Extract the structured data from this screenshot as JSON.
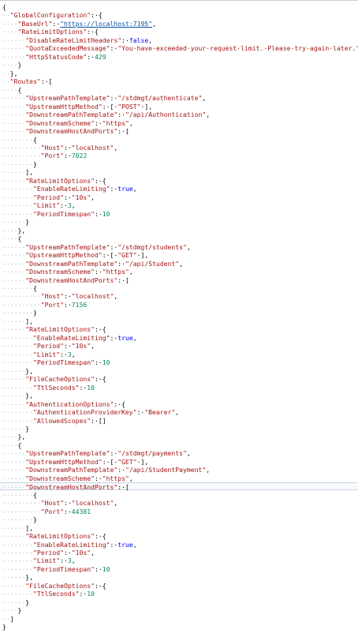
{
  "editor": {
    "highlighted_line_index": 58,
    "lines": [
      [
        [
          "p",
          "{"
        ]
      ],
      [
        [
          "ws",
          "··"
        ],
        [
          "k",
          "\"GlobalConfiguration\""
        ],
        [
          "p",
          ":·{"
        ]
      ],
      [
        [
          "ws",
          "····"
        ],
        [
          "k",
          "\"BaseUrl\""
        ],
        [
          "p",
          ":·"
        ],
        [
          "u",
          "\"https://localhost:7195\""
        ],
        [
          "p",
          ","
        ]
      ],
      [
        [
          "ws",
          "····"
        ],
        [
          "k",
          "\"RateLimitOptions\""
        ],
        [
          "p",
          ":·{"
        ]
      ],
      [
        [
          "ws",
          "······"
        ],
        [
          "k",
          "\"DisableRateLimitHeaders\""
        ],
        [
          "p",
          ":·"
        ],
        [
          "b",
          "false"
        ],
        [
          "p",
          ","
        ]
      ],
      [
        [
          "ws",
          "······"
        ],
        [
          "k",
          "\"QuotaExceededMessage\""
        ],
        [
          "p",
          ":·"
        ],
        [
          "s",
          "\"You·have·exceeded·your·request·limit.·Please·try·again·later.\""
        ],
        [
          "p",
          ","
        ]
      ],
      [
        [
          "ws",
          "······"
        ],
        [
          "k",
          "\"HttpStatusCode\""
        ],
        [
          "p",
          ":·"
        ],
        [
          "n",
          "429"
        ]
      ],
      [
        [
          "ws",
          "····"
        ],
        [
          "p",
          "}"
        ]
      ],
      [
        [
          "ws",
          "··"
        ],
        [
          "p",
          "},"
        ]
      ],
      [
        [
          "ws",
          "··"
        ],
        [
          "k",
          "\"Routes\""
        ],
        [
          "p",
          ":·["
        ]
      ],
      [
        [
          "ws",
          "····"
        ],
        [
          "p",
          "{"
        ]
      ],
      [
        [
          "ws",
          "······"
        ],
        [
          "k",
          "\"UpstreamPathTemplate\""
        ],
        [
          "p",
          ":·"
        ],
        [
          "s",
          "\"/stdmgt/authenticate\""
        ],
        [
          "p",
          ","
        ]
      ],
      [
        [
          "ws",
          "······"
        ],
        [
          "k",
          "\"UpstreamHttpMethod\""
        ],
        [
          "p",
          ":·[·"
        ],
        [
          "s",
          "\"POST\""
        ],
        [
          "p",
          "·],"
        ]
      ],
      [
        [
          "ws",
          "······"
        ],
        [
          "k",
          "\"DownstreamPathTemplate\""
        ],
        [
          "p",
          ":·"
        ],
        [
          "s",
          "\"/api/Authontication\""
        ],
        [
          "p",
          ","
        ]
      ],
      [
        [
          "ws",
          "······"
        ],
        [
          "k",
          "\"DownstreamScheme\""
        ],
        [
          "p",
          ":·"
        ],
        [
          "s",
          "\"https\""
        ],
        [
          "p",
          ","
        ]
      ],
      [
        [
          "ws",
          "······"
        ],
        [
          "k",
          "\"DownstreamHostAndPorts\""
        ],
        [
          "p",
          ":·["
        ]
      ],
      [
        [
          "ws",
          "········"
        ],
        [
          "p",
          "{"
        ]
      ],
      [
        [
          "ws",
          "··········"
        ],
        [
          "k",
          "\"Host\""
        ],
        [
          "p",
          ":·"
        ],
        [
          "s",
          "\"localhost\""
        ],
        [
          "p",
          ","
        ]
      ],
      [
        [
          "ws",
          "··········"
        ],
        [
          "k",
          "\"Port\""
        ],
        [
          "p",
          ":·"
        ],
        [
          "n",
          "7022"
        ]
      ],
      [
        [
          "ws",
          "········"
        ],
        [
          "p",
          "}"
        ]
      ],
      [
        [
          "ws",
          "······"
        ],
        [
          "p",
          "],"
        ]
      ],
      [
        [
          "ws",
          "······"
        ],
        [
          "k",
          "\"RateLimitOptions\""
        ],
        [
          "p",
          ":·{"
        ]
      ],
      [
        [
          "ws",
          "········"
        ],
        [
          "k",
          "\"EnableRateLimiting\""
        ],
        [
          "p",
          ":·"
        ],
        [
          "b",
          "true"
        ],
        [
          "p",
          ","
        ]
      ],
      [
        [
          "ws",
          "········"
        ],
        [
          "k",
          "\"Period\""
        ],
        [
          "p",
          ":·"
        ],
        [
          "s",
          "\"10s\""
        ],
        [
          "p",
          ","
        ]
      ],
      [
        [
          "ws",
          "········"
        ],
        [
          "k",
          "\"Limit\""
        ],
        [
          "p",
          ":·"
        ],
        [
          "n",
          "3"
        ],
        [
          "p",
          ","
        ]
      ],
      [
        [
          "ws",
          "········"
        ],
        [
          "k",
          "\"PeriodTimespan\""
        ],
        [
          "p",
          ":·"
        ],
        [
          "n",
          "10"
        ]
      ],
      [
        [
          "ws",
          "······"
        ],
        [
          "p",
          "}"
        ]
      ],
      [
        [
          "ws",
          "····"
        ],
        [
          "p",
          "},"
        ]
      ],
      [
        [
          "ws",
          "····"
        ],
        [
          "p",
          "{"
        ]
      ],
      [
        [
          "ws",
          "······"
        ],
        [
          "k",
          "\"UpstreamPathTemplate\""
        ],
        [
          "p",
          ":·"
        ],
        [
          "s",
          "\"/stdmgt/students\""
        ],
        [
          "p",
          ","
        ]
      ],
      [
        [
          "ws",
          "······"
        ],
        [
          "k",
          "\"UpstreamHttpMethod\""
        ],
        [
          "p",
          ":·[·"
        ],
        [
          "s",
          "\"GET\""
        ],
        [
          "p",
          "·],"
        ]
      ],
      [
        [
          "ws",
          "······"
        ],
        [
          "k",
          "\"DownstreamPathTemplate\""
        ],
        [
          "p",
          ":·"
        ],
        [
          "s",
          "\"/api/Student\""
        ],
        [
          "p",
          ","
        ]
      ],
      [
        [
          "ws",
          "······"
        ],
        [
          "k",
          "\"DownstreamScheme\""
        ],
        [
          "p",
          ":·"
        ],
        [
          "s",
          "\"https\""
        ],
        [
          "p",
          ","
        ]
      ],
      [
        [
          "ws",
          "······"
        ],
        [
          "k",
          "\"DownstreamHostAndPorts\""
        ],
        [
          "p",
          ":·["
        ]
      ],
      [
        [
          "ws",
          "········"
        ],
        [
          "p",
          "{"
        ]
      ],
      [
        [
          "ws",
          "··········"
        ],
        [
          "k",
          "\"Host\""
        ],
        [
          "p",
          ":·"
        ],
        [
          "s",
          "\"localhost\""
        ],
        [
          "p",
          ","
        ]
      ],
      [
        [
          "ws",
          "··········"
        ],
        [
          "k",
          "\"Port\""
        ],
        [
          "p",
          ":·"
        ],
        [
          "n",
          "7156"
        ]
      ],
      [
        [
          "ws",
          "········"
        ],
        [
          "p",
          "}"
        ]
      ],
      [
        [
          "ws",
          "······"
        ],
        [
          "p",
          "],"
        ]
      ],
      [
        [
          "ws",
          "······"
        ],
        [
          "k",
          "\"RateLimitOptions\""
        ],
        [
          "p",
          ":·{"
        ]
      ],
      [
        [
          "ws",
          "········"
        ],
        [
          "k",
          "\"EnableRateLimiting\""
        ],
        [
          "p",
          ":·"
        ],
        [
          "b",
          "true"
        ],
        [
          "p",
          ","
        ]
      ],
      [
        [
          "ws",
          "········"
        ],
        [
          "k",
          "\"Period\""
        ],
        [
          "p",
          ":·"
        ],
        [
          "s",
          "\"10s\""
        ],
        [
          "p",
          ","
        ]
      ],
      [
        [
          "ws",
          "········"
        ],
        [
          "k",
          "\"Limit\""
        ],
        [
          "p",
          ":·"
        ],
        [
          "n",
          "3"
        ],
        [
          "p",
          ","
        ]
      ],
      [
        [
          "ws",
          "········"
        ],
        [
          "k",
          "\"PeriodTimespan\""
        ],
        [
          "p",
          ":·"
        ],
        [
          "n",
          "10"
        ]
      ],
      [
        [
          "ws",
          "······"
        ],
        [
          "p",
          "},"
        ]
      ],
      [
        [
          "ws",
          "······"
        ],
        [
          "k",
          "\"FileCacheOptions\""
        ],
        [
          "p",
          ":·{"
        ]
      ],
      [
        [
          "ws",
          "········"
        ],
        [
          "k",
          "\"TtlSeconds\""
        ],
        [
          "p",
          ":·"
        ],
        [
          "n",
          "10"
        ]
      ],
      [
        [
          "ws",
          "······"
        ],
        [
          "p",
          "},"
        ]
      ],
      [
        [
          "ws",
          "······"
        ],
        [
          "k",
          "\"AuthenticationOptions\""
        ],
        [
          "p",
          ":·{"
        ]
      ],
      [
        [
          "ws",
          "········"
        ],
        [
          "k",
          "\"AuthenticationProviderKey\""
        ],
        [
          "p",
          ":·"
        ],
        [
          "s",
          "\"Bearer\""
        ],
        [
          "p",
          ","
        ]
      ],
      [
        [
          "ws",
          "········"
        ],
        [
          "k",
          "\"AllowedScopes\""
        ],
        [
          "p",
          ":·[]"
        ]
      ],
      [
        [
          "ws",
          "······"
        ],
        [
          "p",
          "}"
        ]
      ],
      [
        [
          "ws",
          "····"
        ],
        [
          "p",
          "},"
        ]
      ],
      [
        [
          "ws",
          "····"
        ],
        [
          "p",
          "{"
        ]
      ],
      [
        [
          "ws",
          "······"
        ],
        [
          "k",
          "\"UpstreamPathTemplate\""
        ],
        [
          "p",
          ":·"
        ],
        [
          "s",
          "\"/stdmgt/payments\""
        ],
        [
          "p",
          ","
        ]
      ],
      [
        [
          "ws",
          "······"
        ],
        [
          "k",
          "\"UpstreamHttpMethod\""
        ],
        [
          "p",
          ":·[·"
        ],
        [
          "s",
          "\"GET\""
        ],
        [
          "p",
          "·],"
        ]
      ],
      [
        [
          "ws",
          "······"
        ],
        [
          "k",
          "\"DownstreamPathTemplate\""
        ],
        [
          "p",
          ":·"
        ],
        [
          "s",
          "\"/api/StudentPayment\""
        ],
        [
          "p",
          ","
        ]
      ],
      [
        [
          "ws",
          "······"
        ],
        [
          "k",
          "\"DownstreamScheme\""
        ],
        [
          "p",
          ":·"
        ],
        [
          "s",
          "\"https\""
        ],
        [
          "p",
          ","
        ]
      ],
      [
        [
          "ws",
          "······"
        ],
        [
          "k",
          "\"DownstreamHostAndPorts\""
        ],
        [
          "p",
          ":·["
        ]
      ],
      [
        [
          "ws",
          "········"
        ],
        [
          "p",
          "{"
        ]
      ],
      [
        [
          "ws",
          "··········"
        ],
        [
          "k",
          "\"Host\""
        ],
        [
          "p",
          ":·"
        ],
        [
          "s",
          "\"localhost\""
        ],
        [
          "p",
          ","
        ]
      ],
      [
        [
          "ws",
          "··········"
        ],
        [
          "k",
          "\"Port\""
        ],
        [
          "p",
          ":·"
        ],
        [
          "n",
          "44381"
        ]
      ],
      [
        [
          "ws",
          "········"
        ],
        [
          "p",
          "}"
        ]
      ],
      [
        [
          "ws",
          "······"
        ],
        [
          "p",
          "],"
        ]
      ],
      [
        [
          "ws",
          "······"
        ],
        [
          "k",
          "\"RateLimitOptions\""
        ],
        [
          "p",
          ":·{"
        ]
      ],
      [
        [
          "ws",
          "········"
        ],
        [
          "k",
          "\"EnableRateLimiting\""
        ],
        [
          "p",
          ":·"
        ],
        [
          "b",
          "true"
        ],
        [
          "p",
          ","
        ]
      ],
      [
        [
          "ws",
          "········"
        ],
        [
          "k",
          "\"Period\""
        ],
        [
          "p",
          ":·"
        ],
        [
          "s",
          "\"10s\""
        ],
        [
          "p",
          ","
        ]
      ],
      [
        [
          "ws",
          "········"
        ],
        [
          "k",
          "\"Limit\""
        ],
        [
          "p",
          ":·"
        ],
        [
          "n",
          "3"
        ],
        [
          "p",
          ","
        ]
      ],
      [
        [
          "ws",
          "········"
        ],
        [
          "k",
          "\"PeriodTimespan\""
        ],
        [
          "p",
          ":·"
        ],
        [
          "n",
          "10"
        ]
      ],
      [
        [
          "ws",
          "······"
        ],
        [
          "p",
          "},"
        ]
      ],
      [
        [
          "ws",
          "······"
        ],
        [
          "k",
          "\"FileCacheOptions\""
        ],
        [
          "p",
          ":·{"
        ]
      ],
      [
        [
          "ws",
          "········"
        ],
        [
          "k",
          "\"TtlSeconds\""
        ],
        [
          "p",
          ":·"
        ],
        [
          "n",
          "10"
        ]
      ],
      [
        [
          "ws",
          "······"
        ],
        [
          "p",
          "}"
        ]
      ],
      [
        [
          "ws",
          "····"
        ],
        [
          "p",
          "}"
        ]
      ],
      [
        [
          "ws",
          "··"
        ],
        [
          "p",
          "]"
        ]
      ],
      [
        [
          "p",
          "}"
        ]
      ]
    ]
  }
}
